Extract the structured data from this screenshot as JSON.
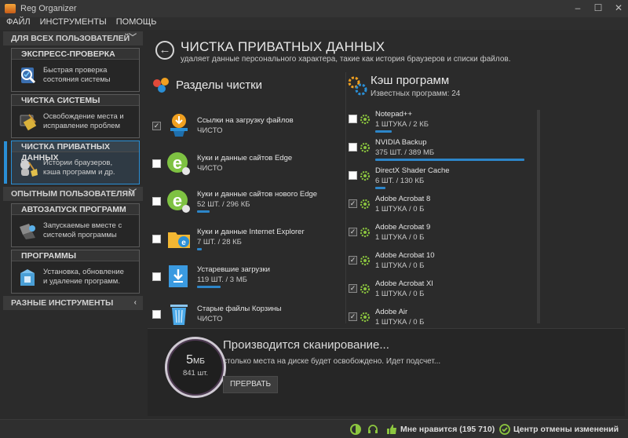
{
  "window": {
    "title": "Reg Organizer",
    "controls": [
      "minimize-icon",
      "maximize-icon",
      "close-icon"
    ]
  },
  "menu": [
    "ФАЙЛ",
    "ИНСТРУМЕНТЫ",
    "ПОМОЩЬ"
  ],
  "sidebar": {
    "section_all": "ДЛЯ ВСЕХ ПОЛЬЗОВАТЕЛЕЙ",
    "section_exp": "ОПЫТНЫМ ПОЛЬЗОВАТЕЛЯМ",
    "section_misc": "РАЗНЫЕ ИНСТРУМЕНТЫ",
    "cards": [
      {
        "title": "ЭКСПРЕСС-ПРОВЕРКА",
        "line1": "Быстрая проверка",
        "line2": "состояния системы",
        "icon": "checklist-icon"
      },
      {
        "title": "ЧИСТКА СИСТЕМЫ",
        "line1": "Освобождение места и",
        "line2": "исправление проблем",
        "icon": "broom-icon"
      },
      {
        "title": "ЧИСТКА ПРИВАТНЫХ ДАННЫХ",
        "line1": "Истории браузеров,",
        "line2": "кэша программ и др.",
        "icon": "privacy-broom-icon"
      },
      {
        "title": "АВТОЗАПУСК ПРОГРАММ",
        "line1": "Запускаемые вместе с",
        "line2": "системой программы",
        "icon": "autorun-icon"
      },
      {
        "title": "ПРОГРАММЫ",
        "line1": "Установка, обновление",
        "line2": "и удаление программ.",
        "icon": "uninstall-icon"
      }
    ]
  },
  "main": {
    "title": "ЧИСТКА ПРИВАТНЫХ ДАННЫХ",
    "subtitle": "удаляет данные персонального характера, такие как история браузеров и списки файлов.",
    "sections_head": "Разделы чистки",
    "cache_head": "Кэш программ",
    "cache_known": "Известных программ: 24",
    "clean_items": [
      {
        "title": "Ссылки на загрузку файлов",
        "value": "ЧИСТО",
        "checked": true,
        "icon": "download-links-icon",
        "bar": 0
      },
      {
        "title": "Куки и данные сайтов Edge",
        "value": "ЧИСТО",
        "checked": false,
        "icon": "edge-icon",
        "bar": 0
      },
      {
        "title": "Куки и данные сайтов нового Edge",
        "value": "52 ШТ. / 296 КБ",
        "checked": false,
        "icon": "new-edge-icon",
        "bar": 0.08
      },
      {
        "title": "Куки и данные Internet Explorer",
        "value": "7 ШТ. / 28 КБ",
        "checked": false,
        "icon": "ie-folder-icon",
        "bar": 0.03
      },
      {
        "title": "Устаревшие загрузки",
        "value": "119 ШТ. / 3 МБ",
        "checked": false,
        "icon": "old-downloads-icon",
        "bar": 0.15
      },
      {
        "title": "Старые файлы Корзины",
        "value": "ЧИСТО",
        "checked": false,
        "icon": "recycle-bin-icon",
        "bar": 0
      }
    ],
    "cache_items": [
      {
        "title": "Notepad++",
        "value": "1 ШТУКА / 2 КБ",
        "checked": false,
        "bar": 0.11
      },
      {
        "title": "NVIDIA Backup",
        "value": "375 ШТ. / 389 МБ",
        "checked": false,
        "bar": 1
      },
      {
        "title": "DirectX Shader Cache",
        "value": "6 ШТ. / 130 КБ",
        "checked": false,
        "bar": 0.07
      },
      {
        "title": "Adobe Acrobat 8",
        "value": "1 ШТУКА / 0 Б",
        "checked": true,
        "bar": 0
      },
      {
        "title": "Adobe Acrobat 9",
        "value": "1 ШТУКА / 0 Б",
        "checked": true,
        "bar": 0
      },
      {
        "title": "Adobe Acrobat 10",
        "value": "1 ШТУКА / 0 Б",
        "checked": true,
        "bar": 0
      },
      {
        "title": "Adobe Acrobat XI",
        "value": "1 ШТУКА / 0 Б",
        "checked": true,
        "bar": 0
      },
      {
        "title": "Adobe Air",
        "value": "1 ШТУКА / 0 Б",
        "checked": true,
        "bar": 0
      }
    ]
  },
  "scan": {
    "size_value": "5",
    "size_unit": "МБ",
    "count": "841 шт.",
    "title": "Производится сканирование...",
    "desc": "столько места на диске будет освобождено. Идет подсчет...",
    "stop_label": "ПРЕРВАТЬ"
  },
  "status": {
    "likes": "Мне нравится (195 710)",
    "undo": "Центр отмены изменений"
  },
  "colors": {
    "accent": "#2a8fd6",
    "bar": "#2d86c9",
    "gear": "#8cc63f"
  }
}
